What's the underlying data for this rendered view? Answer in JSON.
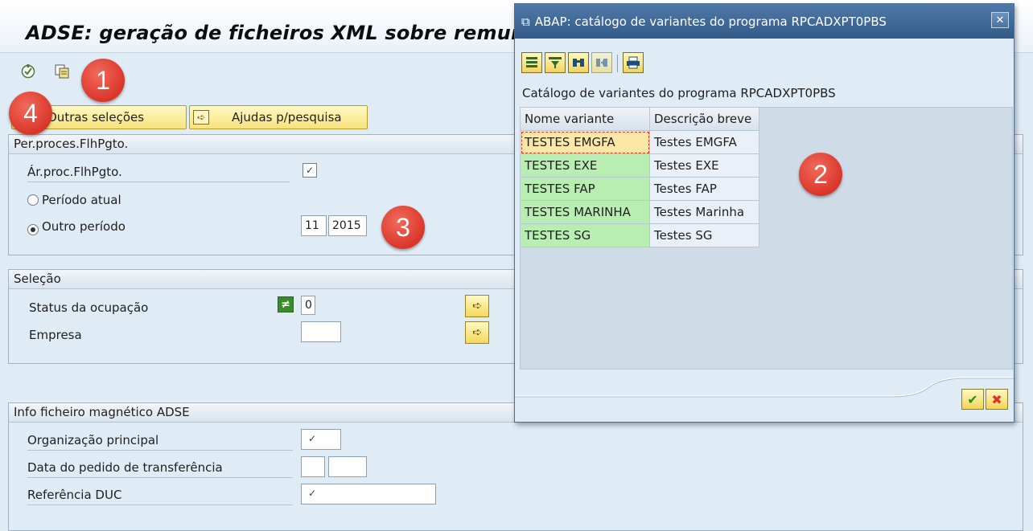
{
  "window": {
    "title": "ADSE: geração de ficheiros XML sobre remuner"
  },
  "toolbar": {
    "icons": [
      "execute-icon",
      "get-variant-icon"
    ]
  },
  "buttons": {
    "other_selections": "Outras seleções",
    "search_help": "Ajudas p/pesquisa"
  },
  "groups": {
    "period": {
      "title": "Per.proces.FlhPgto.",
      "area_label": "Ár.proc.FlhPgto.",
      "current_period": "Período atual",
      "other_period": "Outro período",
      "month": "11",
      "year": "2015"
    },
    "selection": {
      "title": "Seleção",
      "status_label": "Status da ocupação",
      "status_value": "0",
      "company_label": "Empresa"
    },
    "adse": {
      "title": "Info ficheiro magnético ADSE",
      "org_label": "Organização principal",
      "date_label": "Data do pedido de transferência",
      "ref_label": "Referência DUC"
    }
  },
  "markers": [
    "1",
    "2",
    "3",
    "4"
  ],
  "dialog": {
    "title": "ABAP: catálogo de variantes do programa RPCADXPT0PBS",
    "subtitle": "Catálogo de variantes do programa RPCADXPT0PBS",
    "columns": [
      "Nome variante",
      "Descrição breve"
    ],
    "rows": [
      {
        "name": "TESTES EMGFA",
        "desc": "Testes EMGFA"
      },
      {
        "name": "TESTES EXE",
        "desc": "Testes EXE"
      },
      {
        "name": "TESTES FAP",
        "desc": "Testes FAP"
      },
      {
        "name": "TESTES MARINHA",
        "desc": "Testes Marinha"
      },
      {
        "name": "TESTES SG",
        "desc": "Testes SG"
      }
    ]
  },
  "colors": {
    "marker": "#d9362a",
    "key_cell": "#b9eeb2",
    "dialog_title": "#3d6593"
  }
}
